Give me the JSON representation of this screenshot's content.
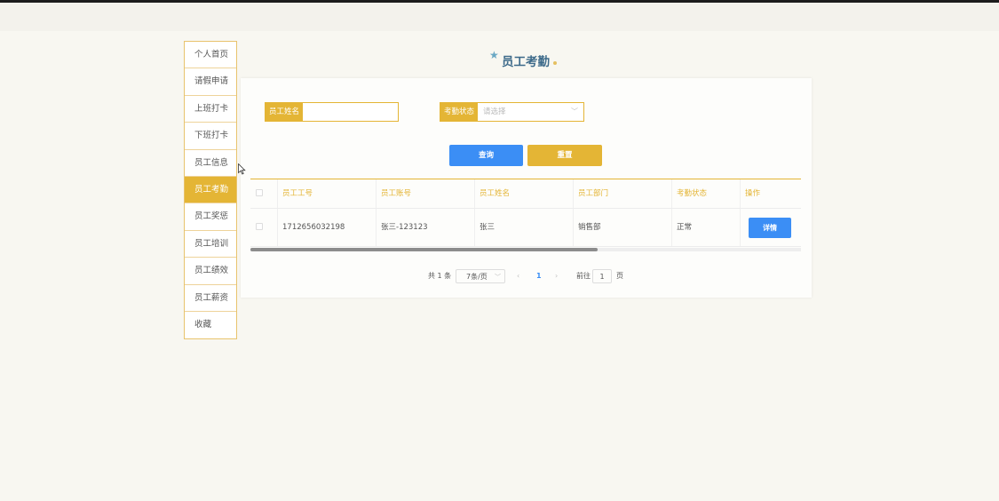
{
  "sidebar": {
    "items": [
      {
        "label": "个人首页"
      },
      {
        "label": "请假申请"
      },
      {
        "label": "上班打卡"
      },
      {
        "label": "下班打卡"
      },
      {
        "label": "员工信息"
      },
      {
        "label": "员工考勤"
      },
      {
        "label": "员工奖惩"
      },
      {
        "label": "员工培训"
      },
      {
        "label": "员工绩效"
      },
      {
        "label": "员工薪资"
      },
      {
        "label": "收藏"
      }
    ],
    "active_label": "员工考勤"
  },
  "page": {
    "title": "员工考勤",
    "title_icon": "star-icon"
  },
  "search": {
    "name_label": "员工姓名",
    "name_value": "",
    "status_label": "考勤状态",
    "status_placeholder": "请选择",
    "query_label": "查询",
    "reset_label": "重置"
  },
  "table": {
    "columns": [
      "员工工号",
      "员工账号",
      "员工姓名",
      "员工部门",
      "考勤状态",
      "操作"
    ],
    "rows": [
      {
        "id": "1712656032198",
        "account": "张三-123123",
        "name": "张三",
        "dept": "销售部",
        "status": "正常",
        "action": "详情"
      }
    ],
    "scroll_fraction": 0.63
  },
  "pager": {
    "total": "共 1 条",
    "page_size": "7条/页",
    "prev_icon": "‹",
    "current_page": "1",
    "next_icon": "›",
    "goto_label": "前往",
    "goto_value": "1",
    "page_unit": "页"
  },
  "colors": {
    "accent": "#e4b535",
    "primary": "#3b8ef5",
    "background": "#f8f7f1"
  }
}
